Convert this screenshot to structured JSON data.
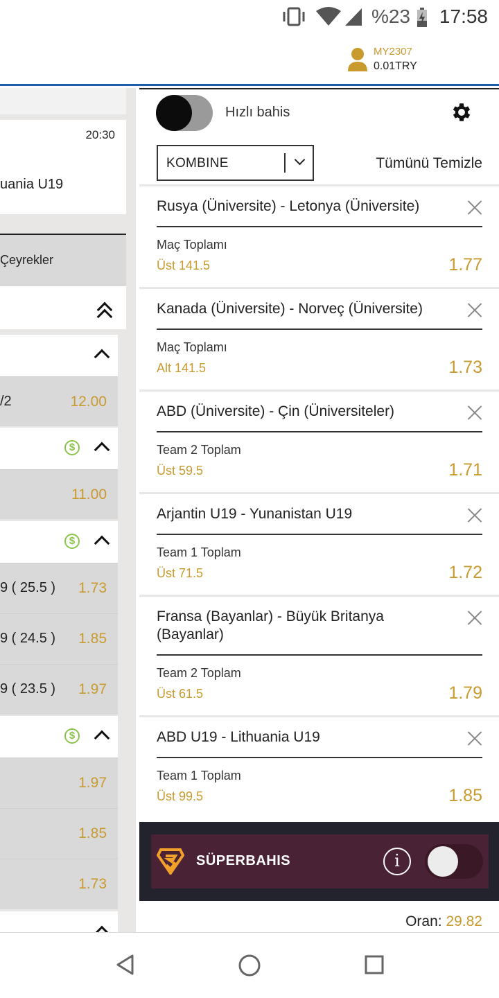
{
  "status_bar": {
    "battery": "%23",
    "time": "17:58",
    "icons": [
      "vibrate-icon",
      "wifi-icon",
      "signal-icon",
      "battery-charging-icon"
    ]
  },
  "header": {
    "username": "MY2307",
    "balance": "0.01TRY",
    "icon": "user-icon"
  },
  "left_panel": {
    "match_time": "20:30",
    "match_name": "uania U19",
    "quarters_label": "Çeyrekler",
    "rows": [
      {
        "label": "/2",
        "odd": "12.00"
      },
      {
        "label": "",
        "odd": "11.00"
      },
      {
        "label": "9 ( 25.5 )",
        "odd": "1.73"
      },
      {
        "label": "9 ( 24.5 )",
        "odd": "1.85"
      },
      {
        "label": "9 ( 23.5 )",
        "odd": "1.97"
      },
      {
        "label": "",
        "odd": "1.97"
      },
      {
        "label": "",
        "odd": "1.85"
      },
      {
        "label": "",
        "odd": "1.73"
      }
    ]
  },
  "betslip": {
    "fast_bet_label": "Hızlı bahis",
    "fast_bet_on": false,
    "bet_type": "KOMBINE",
    "clear_all": "Tümünü Temizle",
    "bets": [
      {
        "match": "Rusya (Üniversite) - Letonya (Üniversite)",
        "market": "Maç Toplamı",
        "selection": "Üst 141.5",
        "odd": "1.77"
      },
      {
        "match": "Kanada (Üniversite) - Norveç (Üniversite)",
        "market": "Maç Toplamı",
        "selection": "Alt 141.5",
        "odd": "1.73"
      },
      {
        "match": "ABD (Üniversite) - Çin (Üniversiteler)",
        "market": "Team 2 Toplam",
        "selection": "Üst 59.5",
        "odd": "1.71"
      },
      {
        "match": "Arjantin U19 - Yunanistan U19",
        "market": "Team 1 Toplam",
        "selection": "Üst 71.5",
        "odd": "1.72"
      },
      {
        "match": "Fransa (Bayanlar) - Büyük Britanya (Bayanlar)",
        "market": "Team 2 Toplam",
        "selection": "Üst 61.5",
        "odd": "1.79"
      },
      {
        "match": "ABD U19 - Lithuania U19",
        "market": "Team 1 Toplam",
        "selection": "Üst 99.5",
        "odd": "1.85"
      }
    ],
    "superbahis_label": "SÜPERBAHIS",
    "superbahis_on": false,
    "oran_label": "Oran:",
    "oran_value": "29.82"
  },
  "colors": {
    "accent_gold": "#c99a2e",
    "header_line": "#1a5fa8",
    "superbahis_bg": "#4a2235"
  }
}
